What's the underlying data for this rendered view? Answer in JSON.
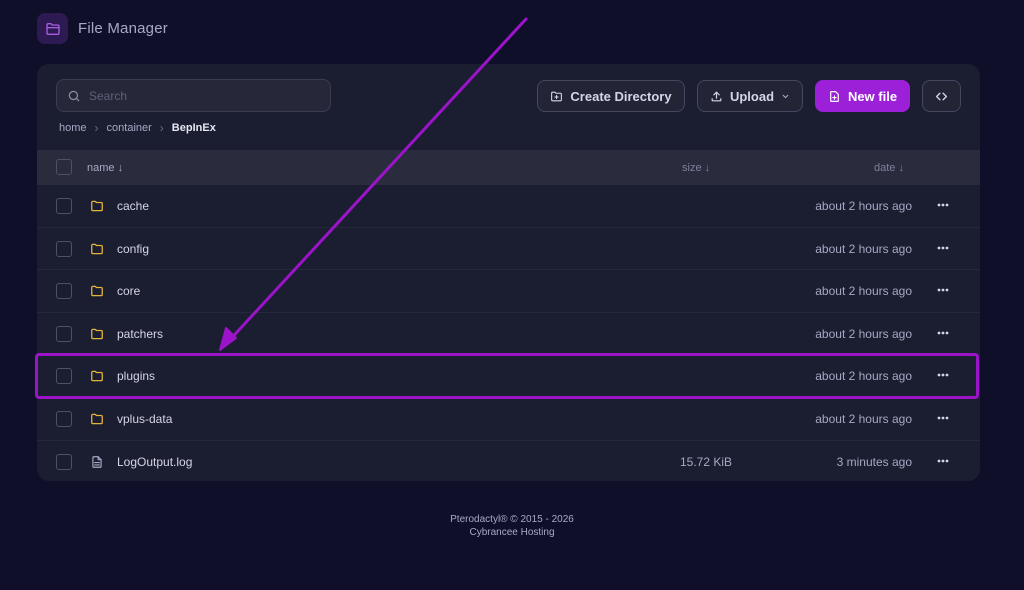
{
  "header": {
    "title": "File Manager",
    "icon": "folder-icon"
  },
  "search": {
    "placeholder": "Search",
    "value": ""
  },
  "toolbar": {
    "create_label": "Create Directory",
    "upload_label": "Upload",
    "new_file_label": "New file",
    "accent_color": "#9c20d8"
  },
  "breadcrumb": {
    "items": [
      "home",
      "container"
    ],
    "current": "BepInEx"
  },
  "table": {
    "columns": {
      "name": "name ↓",
      "size": "size ↓",
      "date": "date ↓"
    },
    "rows": [
      {
        "icon": "folder-icon",
        "name": "cache",
        "size": "",
        "date": "about 2 hours ago"
      },
      {
        "icon": "folder-icon",
        "name": "config",
        "size": "",
        "date": "about 2 hours ago"
      },
      {
        "icon": "folder-icon",
        "name": "core",
        "size": "",
        "date": "about 2 hours ago"
      },
      {
        "icon": "folder-icon",
        "name": "patchers",
        "size": "",
        "date": "about 2 hours ago"
      },
      {
        "icon": "folder-icon",
        "name": "plugins",
        "size": "",
        "date": "about 2 hours ago",
        "highlighted": true
      },
      {
        "icon": "folder-icon",
        "name": "vplus-data",
        "size": "",
        "date": "about 2 hours ago"
      },
      {
        "icon": "file-icon",
        "name": "LogOutput.log",
        "size": "15.72 KiB",
        "date": "3 minutes ago"
      }
    ]
  },
  "annotation": {
    "highlight_color": "#9b14c9"
  },
  "footer": {
    "line1": "Pterodactyl® © 2015 - 2026",
    "line2": "Cybrancee Hosting"
  }
}
